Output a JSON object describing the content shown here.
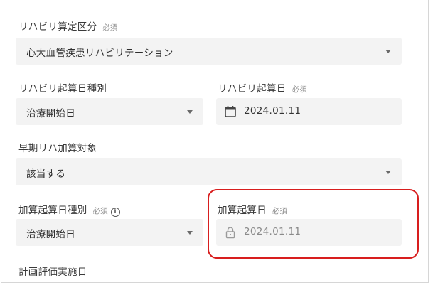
{
  "fields": {
    "rehab_category": {
      "label": "リハビリ算定区分",
      "required": "必須",
      "value": "心大血管疾患リハビリテーション"
    },
    "rehab_start_type": {
      "label": "リハビリ起算日種別",
      "value": "治療開始日"
    },
    "rehab_start_date": {
      "label": "リハビリ起算日",
      "required": "必須",
      "value": "2024.01.11"
    },
    "early_rehab_target": {
      "label": "早期リハ加算対象",
      "value": "該当する"
    },
    "add_start_type": {
      "label": "加算起算日種別",
      "required": "必須",
      "info_icon": "i",
      "value": "治療開始日"
    },
    "add_start_date": {
      "label": "加算起算日",
      "required": "必須",
      "value": "2024.01.11"
    },
    "plan_eval_date": {
      "label": "計画評価実施日"
    }
  },
  "colors": {
    "highlight": "#d81e1e",
    "field_bg": "#f3f3f3"
  },
  "icons": {
    "calendar": "calendar-icon",
    "lock": "lock-icon",
    "dropdown": "chevron-down-icon",
    "info": "info-icon"
  }
}
